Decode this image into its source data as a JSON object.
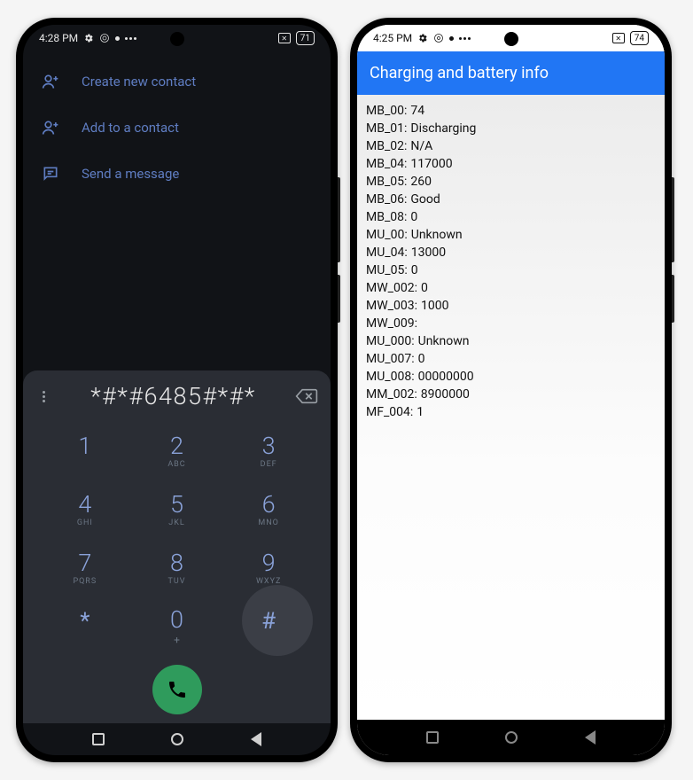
{
  "left": {
    "status": {
      "time": "4:28 PM",
      "battery": "71"
    },
    "actions": [
      {
        "label": "Create new contact"
      },
      {
        "label": "Add to a contact"
      },
      {
        "label": "Send a message"
      }
    ],
    "dial_value": "*#*#6485#*#*",
    "keys": [
      {
        "d": "1",
        "l": ""
      },
      {
        "d": "2",
        "l": "ABC"
      },
      {
        "d": "3",
        "l": "DEF"
      },
      {
        "d": "4",
        "l": "GHI"
      },
      {
        "d": "5",
        "l": "JKL"
      },
      {
        "d": "6",
        "l": "MNO"
      },
      {
        "d": "7",
        "l": "PQRS"
      },
      {
        "d": "8",
        "l": "TUV"
      },
      {
        "d": "9",
        "l": "WXYZ"
      },
      {
        "d": "*",
        "l": ""
      },
      {
        "d": "0",
        "l": "+"
      },
      {
        "d": "#",
        "l": ""
      }
    ]
  },
  "right": {
    "status": {
      "time": "4:25 PM",
      "battery": "74"
    },
    "header": "Charging and battery info",
    "rows": [
      {
        "k": "MB_00:",
        "v": "74"
      },
      {
        "k": "MB_01:",
        "v": "Discharging"
      },
      {
        "k": "MB_02:",
        "v": "N/A"
      },
      {
        "k": "MB_04:",
        "v": "117000"
      },
      {
        "k": "MB_05:",
        "v": "260"
      },
      {
        "k": "MB_06:",
        "v": "Good"
      },
      {
        "k": "MB_08:",
        "v": "0"
      },
      {
        "k": "MU_00:",
        "v": "Unknown"
      },
      {
        "k": "MU_04:",
        "v": "13000"
      },
      {
        "k": "MU_05:",
        "v": "0"
      },
      {
        "k": "MW_002:",
        "v": "0"
      },
      {
        "k": "MW_003:",
        "v": "1000"
      },
      {
        "k": "MW_009:",
        "v": ""
      },
      {
        "k": "MU_000:",
        "v": "Unknown"
      },
      {
        "k": "MU_007:",
        "v": "0"
      },
      {
        "k": "MU_008:",
        "v": "00000000"
      },
      {
        "k": "MM_002:",
        "v": "8900000"
      },
      {
        "k": "MF_004:",
        "v": "1"
      }
    ]
  }
}
